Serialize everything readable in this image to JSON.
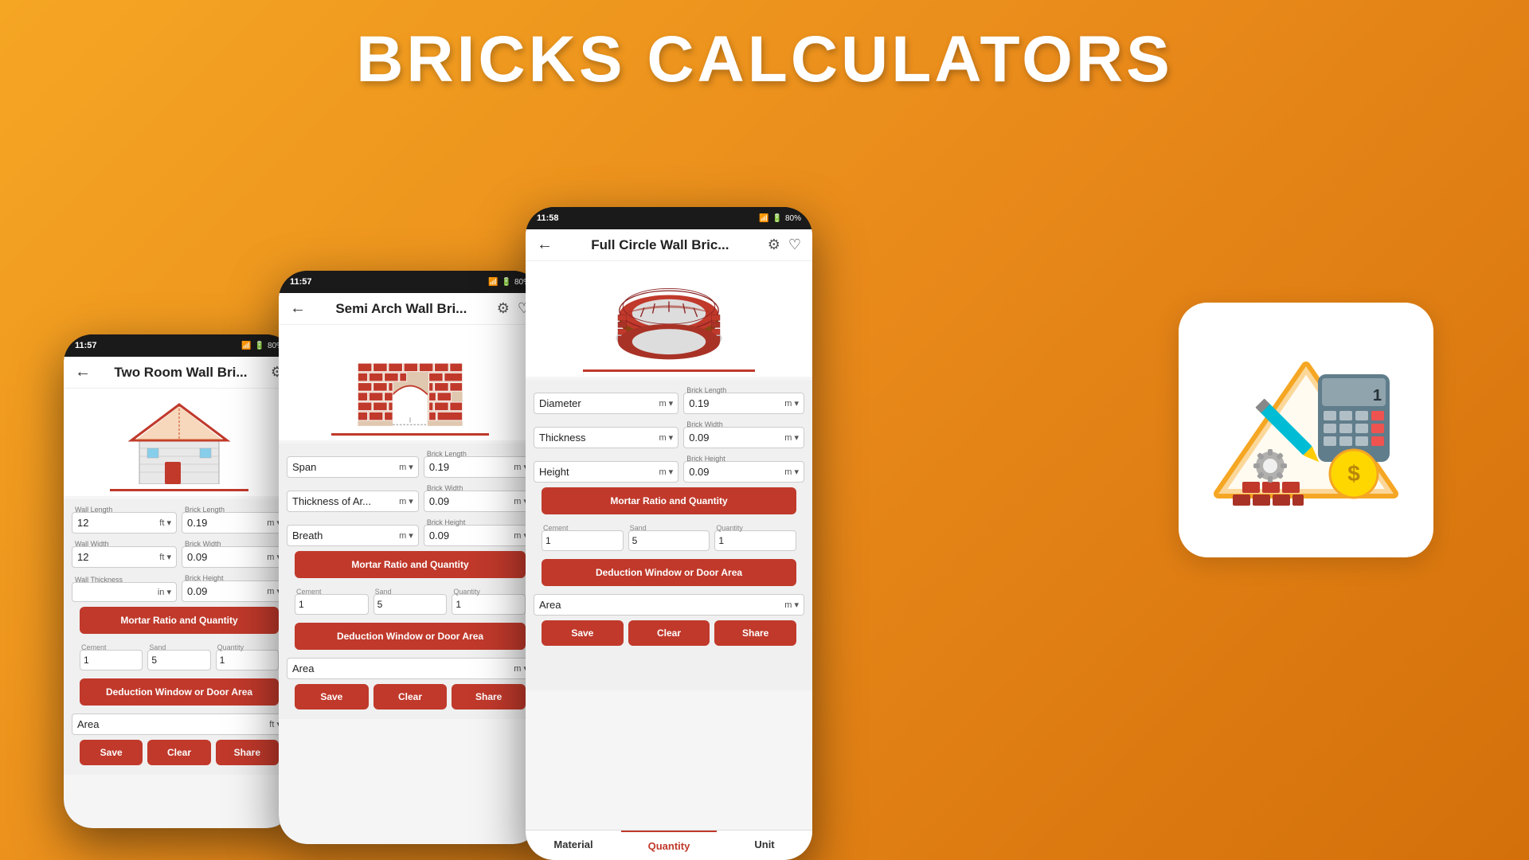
{
  "title": "BRICKS CALCULATORS",
  "phone1": {
    "status_time": "11:57",
    "status_right": "4G 80%",
    "header_title": "Two Room Wall Bri...",
    "fields": [
      {
        "label": "Wall Length",
        "value": "12",
        "unit": "ft"
      },
      {
        "label": "Brick Length",
        "value": "0.19",
        "unit": "m"
      },
      {
        "label": "Wall Width",
        "value": "12",
        "unit": "ft"
      },
      {
        "label": "Brick Width",
        "value": "0.09",
        "unit": "m"
      },
      {
        "label": "Wall Thickness",
        "unit": "in"
      },
      {
        "label": "Brick Height",
        "value": "0.09",
        "unit": "m"
      }
    ],
    "mortar_btn": "Mortar Ratio and Quantity",
    "cement": "1",
    "sand": "5",
    "quantity": "1",
    "deduction_btn": "Deduction Window or Door Area",
    "area_label": "Area",
    "area_unit": "ft",
    "save": "Save",
    "clear": "Clear",
    "share": "Share"
  },
  "phone2": {
    "status_time": "11:57",
    "status_right": "4G 80%",
    "header_title": "Semi Arch Wall Bri...",
    "fields": [
      {
        "label": "Span",
        "unit": "m"
      },
      {
        "label": "Brick Length",
        "value": "0.19",
        "unit": "m"
      },
      {
        "label": "Thickness of Ar...",
        "unit": "m"
      },
      {
        "label": "Brick Width",
        "value": "0.09",
        "unit": "m"
      },
      {
        "label": "Breath",
        "unit": "m"
      },
      {
        "label": "Brick Height",
        "value": "0.09",
        "unit": "m"
      }
    ],
    "mortar_btn": "Mortar Ratio and Quantity",
    "cement": "1",
    "sand": "5",
    "quantity": "1",
    "deduction_btn": "Deduction Window or Door Area",
    "area_label": "Area",
    "area_unit": "m",
    "save": "Save",
    "clear": "Clear",
    "share": "Share"
  },
  "phone3": {
    "status_time": "11:58",
    "status_right": "4G 80%",
    "header_title": "Full Circle Wall Bric...",
    "fields": [
      {
        "label": "Diameter",
        "unit": "m"
      },
      {
        "label": "Brick Length",
        "value": "0.19",
        "unit": "m"
      },
      {
        "label": "Thickness",
        "unit": "m"
      },
      {
        "label": "Brick Width",
        "value": "0.09",
        "unit": "m"
      },
      {
        "label": "Height",
        "unit": "m"
      },
      {
        "label": "Brick Height",
        "value": "0.09",
        "unit": "m"
      }
    ],
    "mortar_btn": "Mortar Ratio and Quantity",
    "cement": "1",
    "sand": "5",
    "quantity": "1",
    "deduction_btn": "Deduction Window or Door Area",
    "area_label": "Area",
    "area_unit": "m",
    "save": "Save",
    "clear": "Clear",
    "share": "Share",
    "nav": [
      "Material",
      "Quantity",
      "Unit"
    ]
  },
  "icon_box": {
    "alt": "Bricks Calculator App Icon with calculator, pencil, ruler and bricks"
  }
}
